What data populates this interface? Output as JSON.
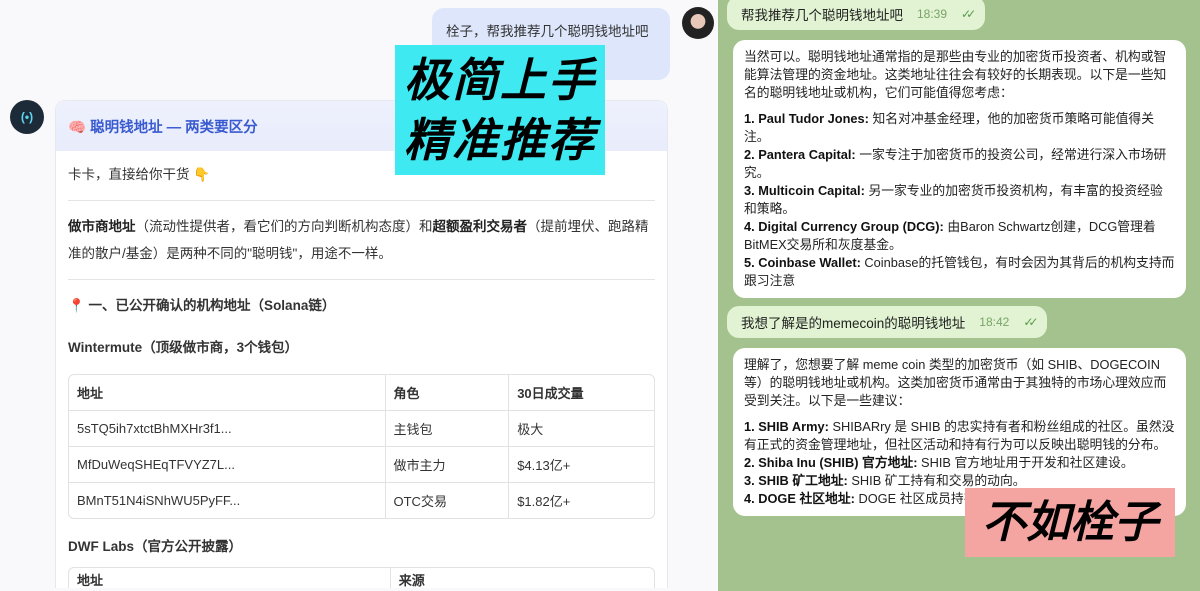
{
  "left": {
    "user_message": "栓子，帮我推荐几个聪明钱地址吧",
    "bot_avatar_text": "(•)",
    "card_title": "🧠 聪明钱地址 — 两类要区分",
    "greeting": "卡卡，直接给你干货 👇",
    "intro": {
      "b1": "做市商地址",
      "t1": "（流动性提供者，看它们的方向判断机构态度）和",
      "b2": "超额盈利交易者",
      "t2": "（提前埋伏、跑路精准的散户/基金）是两种不同的\"聪明钱\"，用途不一样。"
    },
    "section1": "📍 一、已公开确认的机构地址（Solana链）",
    "wintermute_title": "Wintermute（顶级做市商，3个钱包）",
    "table1": {
      "headers": [
        "地址",
        "角色",
        "30日成交量"
      ],
      "rows": [
        [
          "5sTQ5ih7xtctBhMXHr3f1...",
          "主钱包",
          "极大"
        ],
        [
          "MfDuWeqSHEqTFVYZ7L...",
          "做市主力",
          "$4.13亿+"
        ],
        [
          "BMnT51N4iSNhWU5PyFF...",
          "OTC交易",
          "$1.82亿+"
        ]
      ]
    },
    "dwf_title": "DWF Labs（官方公开披露）",
    "table2": {
      "headers": [
        "地址",
        "来源"
      ]
    }
  },
  "overlays": {
    "cyan_line1": "极简上手",
    "cyan_line2": "精准推荐",
    "pink": "不如栓子"
  },
  "right": {
    "msg1": {
      "text": "帮我推荐几个聪明钱地址吧",
      "time": "18:39"
    },
    "reply1": {
      "intro": "当然可以。聪明钱地址通常指的是那些由专业的加密货币投资者、机构或智能算法管理的资金地址。这类地址往往会有较好的长期表现。以下是一些知名的聪明钱地址或机构，它们可能值得您考虑：",
      "items": [
        [
          "1. Paul Tudor Jones:",
          "知名对冲基金经理，他的加密货币策略可能值得关注。"
        ],
        [
          "2. Pantera Capital:",
          "一家专注于加密货币的投资公司，经常进行深入市场研究。"
        ],
        [
          "3. Multicoin Capital:",
          "另一家专业的加密货币投资机构，有丰富的投资经验和策略。"
        ],
        [
          "4. Digital Currency Group (DCG):",
          "由Baron Schwartz创建，DCG管理着BitMEX交易所和灰度基金。"
        ],
        [
          "5. Coinbase Wallet:",
          "Coinbase的托管钱包，有时会因为其背后的机构支持而跟习注意"
        ]
      ]
    },
    "msg2": {
      "text": "我想了解是的memecoin的聪明钱地址",
      "time": "18:42"
    },
    "reply2": {
      "intro": "理解了，您想要了解 meme coin 类型的加密货币（如 SHIB、DOGECOIN 等）的聪明钱地址或机构。这类加密货币通常由于其独特的市场心理效应而受到关注。以下是一些建议：",
      "items": [
        [
          "1. SHIB Army:",
          "SHIBARry 是 SHIB 的忠实持有者和粉丝组成的社区。虽然没有正式的资金管理地址，但社区活动和持有行为可以反映出聪明钱的分布。"
        ],
        [
          "2. Shiba Inu (SHIB) 官方地址:",
          "SHIB 官方地址用于开发和社区建设。"
        ],
        [
          "3. SHIB 矿工地址:",
          "SHIB 矿工持有和交易的动向。"
        ],
        [
          "4. DOGE 社区地址:",
          "DOGE 社区成员持有的地址也可能有聪明钱参与。"
        ]
      ]
    }
  }
}
